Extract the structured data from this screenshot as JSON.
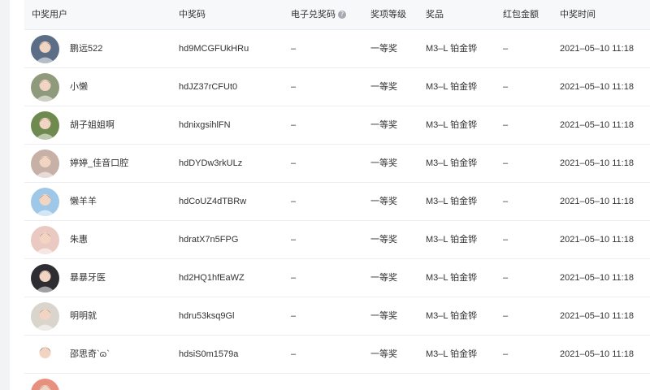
{
  "table": {
    "headers": {
      "user": "中奖用户",
      "code": "中奖码",
      "ecode": "电子兑奖码",
      "level": "奖项等级",
      "prize": "奖品",
      "redpacket": "红包金额",
      "time": "中奖时间"
    },
    "help_icon": "?",
    "rows": [
      {
        "nickname": "鹏远522",
        "code": "hd9MCGFUkHRu",
        "ecode": "–",
        "level": "一等奖",
        "prize": "M3–L 铂金铧",
        "redpacket": "–",
        "time": "2021–05–10 11:18",
        "avatar_color": "#5b6e86"
      },
      {
        "nickname": "小懒",
        "code": "hdJZ37rCFUt0",
        "ecode": "–",
        "level": "一等奖",
        "prize": "M3–L 铂金铧",
        "redpacket": "–",
        "time": "2021–05–10 11:18",
        "avatar_color": "#8f9a7c"
      },
      {
        "nickname": "胡子姐姐啊",
        "code": "hdnixgsihlFN",
        "ecode": "–",
        "level": "一等奖",
        "prize": "M3–L 铂金铧",
        "redpacket": "–",
        "time": "2021–05–10 11:18",
        "avatar_color": "#6f8a4f"
      },
      {
        "nickname": "婷婷_佳音口腔",
        "code": "hdDYDw3rkULz",
        "ecode": "–",
        "level": "一等奖",
        "prize": "M3–L 铂金铧",
        "redpacket": "–",
        "time": "2021–05–10 11:18",
        "avatar_color": "#c7b0a6"
      },
      {
        "nickname": "懒羊羊",
        "code": "hdCoUZ4dTBRw",
        "ecode": "–",
        "level": "一等奖",
        "prize": "M3–L 铂金铧",
        "redpacket": "–",
        "time": "2021–05–10 11:18",
        "avatar_color": "#9ec7e8"
      },
      {
        "nickname": "朱惠",
        "code": "hdratX7n5FPG",
        "ecode": "–",
        "level": "一等奖",
        "prize": "M3–L 铂金铧",
        "redpacket": "–",
        "time": "2021–05–10 11:18",
        "avatar_color": "#e9c9c2"
      },
      {
        "nickname": "暴暴牙医",
        "code": "hd2HQ1hfEaWZ",
        "ecode": "–",
        "level": "一等奖",
        "prize": "M3–L 铂金铧",
        "redpacket": "–",
        "time": "2021–05–10 11:18",
        "avatar_color": "#2e2e32"
      },
      {
        "nickname": "明明就",
        "code": "hdru53ksq9Gl",
        "ecode": "–",
        "level": "一等奖",
        "prize": "M3–L 铂金铧",
        "redpacket": "–",
        "time": "2021–05–10 11:18",
        "avatar_color": "#d9d4cc"
      },
      {
        "nickname": "邵思奇`ɷ`",
        "code": "hdsiS0m1579a",
        "ecode": "–",
        "level": "一等奖",
        "prize": "M3–L 铂金铧",
        "redpacket": "–",
        "time": "2021–05–10 11:18",
        "avatar_color": "#ffffff"
      }
    ],
    "partial_row": {
      "avatar_color": "#e8907f"
    }
  },
  "colors": {
    "header_bg": "#f7f8fa",
    "border": "#ebedf0",
    "text": "#323233",
    "side_strip": "#f2f3f5"
  }
}
